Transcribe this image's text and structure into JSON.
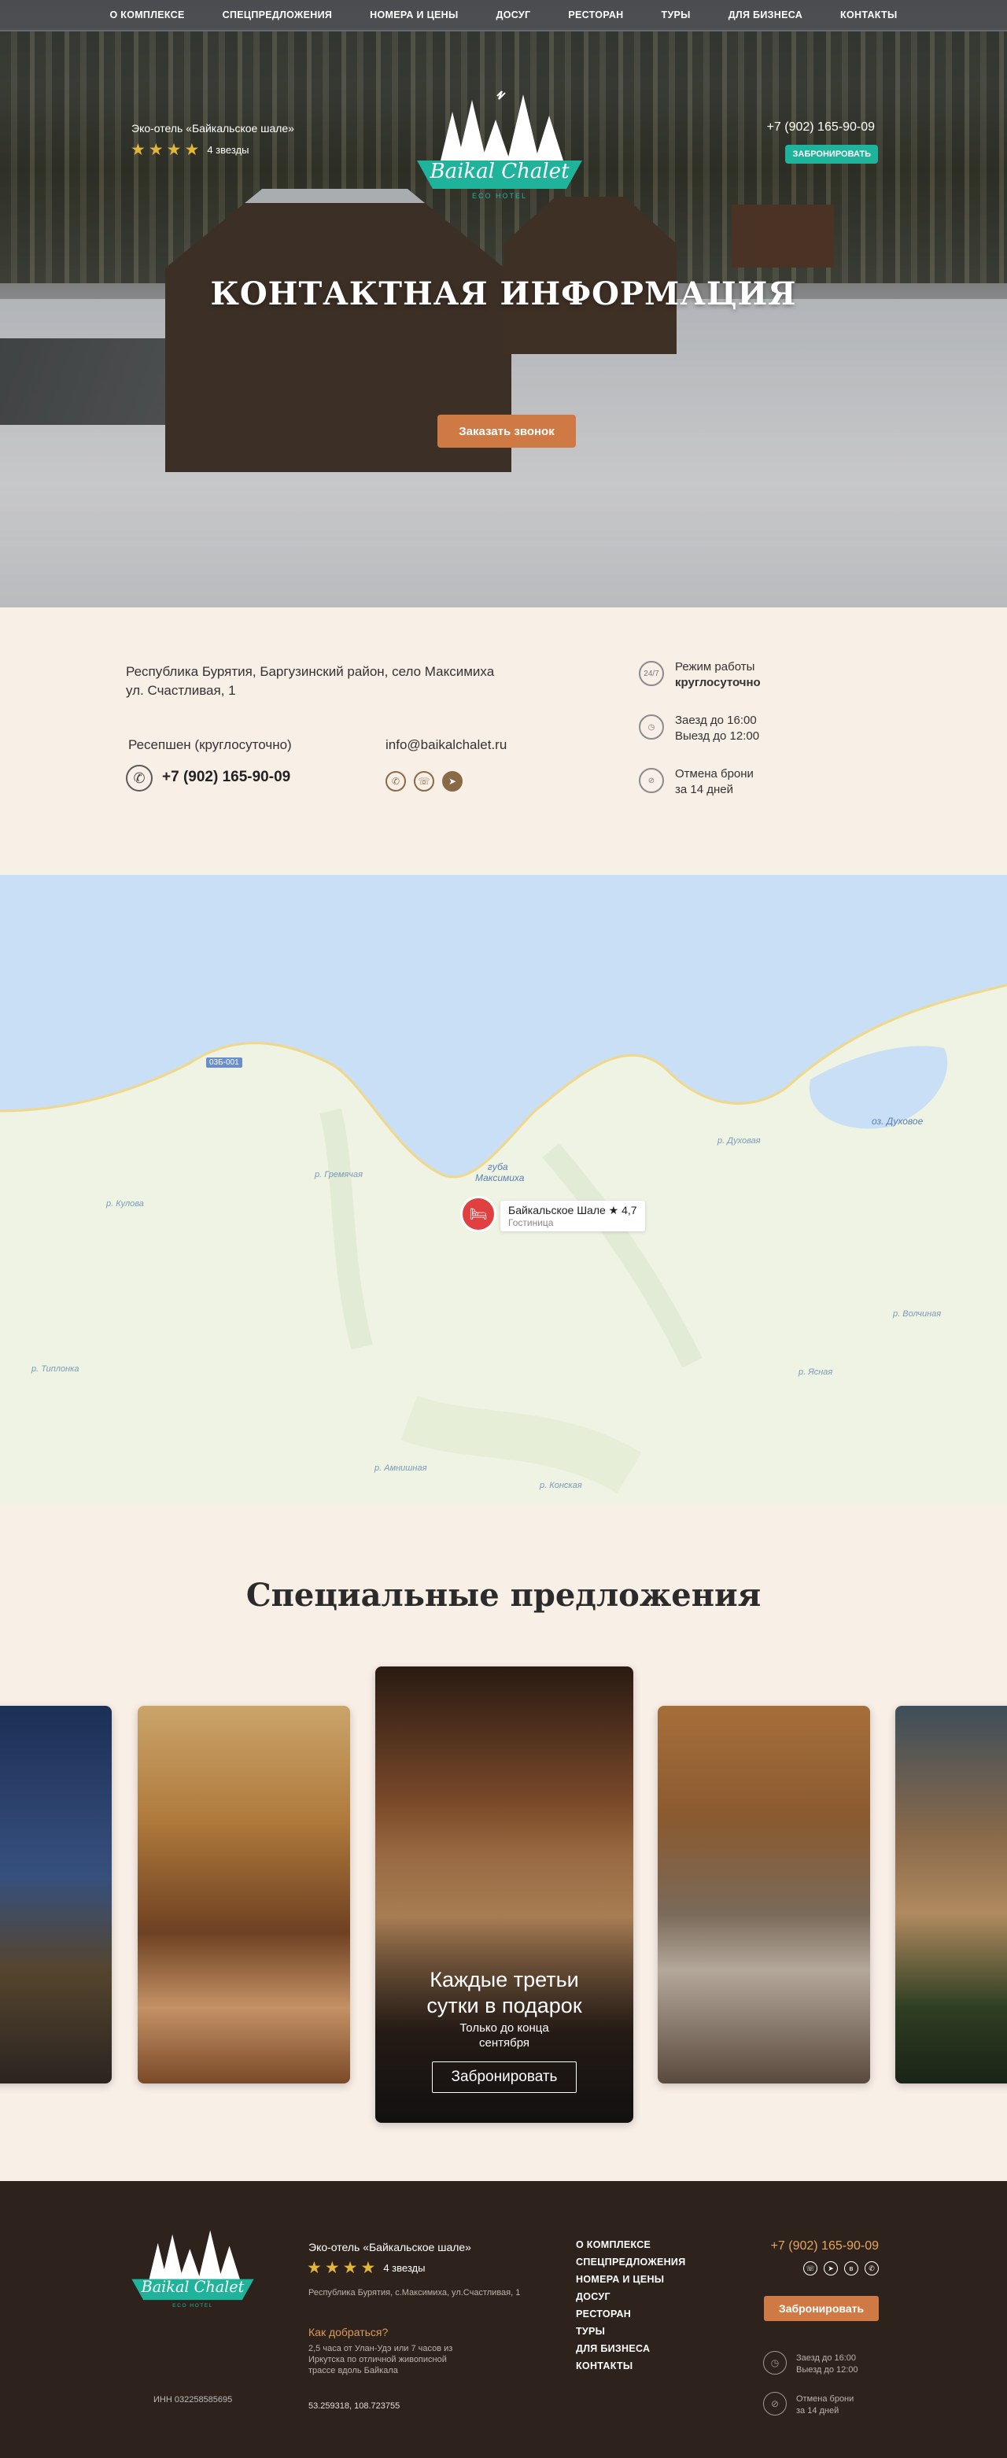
{
  "nav": [
    "О КОМПЛЕКСЕ",
    "СПЕЦПРЕДЛОЖЕНИЯ",
    "НОМЕРА И ЦЕНЫ",
    "ДОСУГ",
    "РЕСТОРАН",
    "ТУРЫ",
    "ДЛЯ БИЗНЕСА",
    "КОНТАКТЫ"
  ],
  "header": {
    "hotel_name": "Эко-отель «Байкальское шале»",
    "stars_count": 4,
    "stars_label": "4 звезды",
    "logo_text": "Baikal Chalet",
    "logo_sub": "ECO HOTEL",
    "phone": "+7 (902) 165-90-09",
    "book_label": "ЗАБРОНИРОВАТЬ"
  },
  "hero": {
    "title": "КОНТАКТНАЯ ИНФОРМАЦИЯ",
    "call_button": "Заказать звонок"
  },
  "contacts": {
    "address_line1": "Республика Бурятия, Баргузинский район, село Максимиха",
    "address_line2": "ул. Счастливая, 1",
    "reception_label": "Ресепшен (круглосуточно)",
    "reception_phone": "+7 (902) 165-90-09",
    "email": "info@baikalchalet.ru",
    "messengers": [
      "whatsapp-icon",
      "viber-icon",
      "telegram-icon"
    ],
    "schedule_icon": "24/7",
    "schedule_label": "Режим работы",
    "schedule_value": "круглосуточно",
    "checkin": "Заезд до 16:00",
    "checkout": "Выезд до 12:00",
    "cancel_line1": "Отмена брони",
    "cancel_line2": "за 14 дней"
  },
  "map": {
    "road_sign": "03Б-001",
    "bay": "губа",
    "bay2": "Максимиха",
    "lake": "оз. Духовое",
    "rivers": [
      "р. Гремячая",
      "р. Кулова",
      "р. Духовая",
      "р. Волчиная",
      "р. Ясная",
      "р. Амнишная",
      "р. Конская",
      "р. Типлонка"
    ],
    "pin_name": "Байкальское Шале ★ 4,7",
    "pin_type": "Гостиница"
  },
  "offers": {
    "title": "Специальные предложения",
    "card_title_line1": "Каждые третьи",
    "card_title_line2": "сутки в подарок",
    "card_sub_line1": "Только до конца",
    "card_sub_line2": "сентября",
    "card_button": "Забронировать"
  },
  "footer": {
    "hotel_name": "Эко-отель «Байкальское шале»",
    "stars_count": 4,
    "stars_label": "4 звезды",
    "address": "Республика Бурятия, с.Максимиха, ул.Счастливая, 1",
    "how_title": "Как добраться?",
    "how_line1": "2,5 часа от Улан-Удэ или 7 часов из",
    "how_line2": "Иркутска по отличной живописной",
    "how_line3": "трассе вдоль Байкала",
    "coords": "53.259318, 108.723755",
    "inn": "ИНН 032258585695",
    "menu": [
      "О КОМПЛЕКСЕ",
      "СПЕЦПРЕДЛОЖЕНИЯ",
      "НОМЕРА И ЦЕНЫ",
      "ДОСУГ",
      "РЕСТОРАН",
      "ТУРЫ",
      "ДЛЯ БИЗНЕСА",
      "КОНТАКТЫ"
    ],
    "phone": "+7 (902) 165-90-09",
    "book_label": "Забронировать",
    "checkin": "Заезд до 16:00",
    "checkout": "Выезд до 12:00",
    "cancel_line1": "Отмена брони",
    "cancel_line2": "за 14 дней"
  },
  "colors": {
    "accent_orange": "#cf7a45",
    "accent_teal": "#1fb39b",
    "star_gold": "#e2b53c",
    "footer_bg": "#2e221c",
    "page_bg": "#f8efe7"
  }
}
